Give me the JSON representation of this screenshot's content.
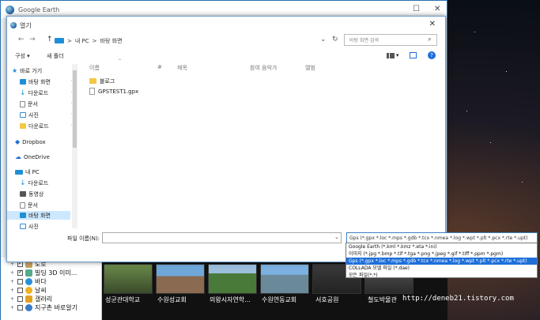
{
  "app": {
    "title": "Google Earth",
    "window_controls": {
      "maximize": "☐",
      "close": "✕"
    }
  },
  "layers": [
    {
      "label": "도로",
      "checked": true
    },
    {
      "label": "빌딩 3D 이미...",
      "checked": true
    },
    {
      "label": "바다",
      "checked": false
    },
    {
      "label": "날씨",
      "checked": false
    },
    {
      "label": "갤러리",
      "checked": false
    },
    {
      "label": "지구촌 바로알기",
      "checked": false
    }
  ],
  "photos": [
    {
      "label": "성균관대학교"
    },
    {
      "label": "수원성교회"
    },
    {
      "label": "의왕시자연학..."
    },
    {
      "label": "수원연동교회"
    },
    {
      "label": "서호공원"
    },
    {
      "label": "철도박물관"
    }
  ],
  "watermark": "http://deneb21.tistory.com",
  "dialog": {
    "title": "열기",
    "close": "✕",
    "nav": {
      "back": "←",
      "forward": "→",
      "up": "↑"
    },
    "breadcrumb": {
      "sep1": ">",
      "pc": "내 PC",
      "sep2": ">",
      "folder": "바탕 화면"
    },
    "address_controls": {
      "dropdown": "⌄",
      "refresh": "↻"
    },
    "search_placeholder": "바탕 화면 검색",
    "toolbar": {
      "organize": "구성 ▾",
      "new_folder": "새 폴더",
      "view": "▾"
    },
    "sidebar": [
      {
        "label": "바로 가기",
        "icon": "star-icon",
        "pinned": false,
        "indent": 0
      },
      {
        "label": "바탕 화면",
        "icon": "desktop-icon",
        "pinned": true,
        "indent": 1,
        "selected": false
      },
      {
        "label": "다운로드",
        "icon": "download-icon",
        "pinned": true,
        "indent": 1
      },
      {
        "label": "문서",
        "icon": "document-icon",
        "pinned": true,
        "indent": 1
      },
      {
        "label": "사진",
        "icon": "picture-icon",
        "pinned": true,
        "indent": 1
      },
      {
        "label": "다운로드",
        "icon": "folder-icon",
        "pinned": true,
        "indent": 1
      },
      {
        "label": "Dropbox",
        "icon": "dropbox-icon",
        "pinned": false,
        "indent": 0
      },
      {
        "label": "OneDrive",
        "icon": "onedrive-icon",
        "pinned": false,
        "indent": 0
      },
      {
        "label": "내 PC",
        "icon": "pc-icon",
        "pinned": false,
        "indent": 0
      },
      {
        "label": "다운로드",
        "icon": "download-icon",
        "pinned": false,
        "indent": 1
      },
      {
        "label": "동영상",
        "icon": "video-icon",
        "pinned": false,
        "indent": 1
      },
      {
        "label": "문서",
        "icon": "document-icon",
        "pinned": false,
        "indent": 1
      },
      {
        "label": "바탕 화면",
        "icon": "desktop-icon",
        "pinned": false,
        "indent": 1,
        "selected": true
      },
      {
        "label": "사진",
        "icon": "picture-icon",
        "pinned": false,
        "indent": 1
      }
    ],
    "columns": {
      "name": "이름",
      "hash": "#",
      "title": "제목",
      "contributors": "참여 음악가",
      "album": "앨범"
    },
    "files": [
      {
        "name": "블로그",
        "type": "folder"
      },
      {
        "name": "GPSTEST1.gpx",
        "type": "file"
      }
    ],
    "filename_label": "파일 이름(N):",
    "filename_value": "",
    "filetype_selected": "Gps (*.gpx *.loc *.mps *.gdb *.tcx *.nmea *.log *.wpt *.plt *.pcx *.rte *.upt)",
    "filetype_options": [
      "Google Earth (*.kml *.kmz *.eta *.ini)",
      "이미지 (*.jpg *.bmp *.tif *.tga *.png *.jpeg *.gif *.tiff *.ppm *.pgm)",
      "Gps (*.gpx *.loc *.mps *.gdb *.tcx *.nmea *.log *.wpt *.plt *.pcx *.rte *.upt)",
      "COLLADA 모델 파일 (*.dae)",
      "모든 파일(*.*)"
    ],
    "filetype_selected_index": 2
  }
}
